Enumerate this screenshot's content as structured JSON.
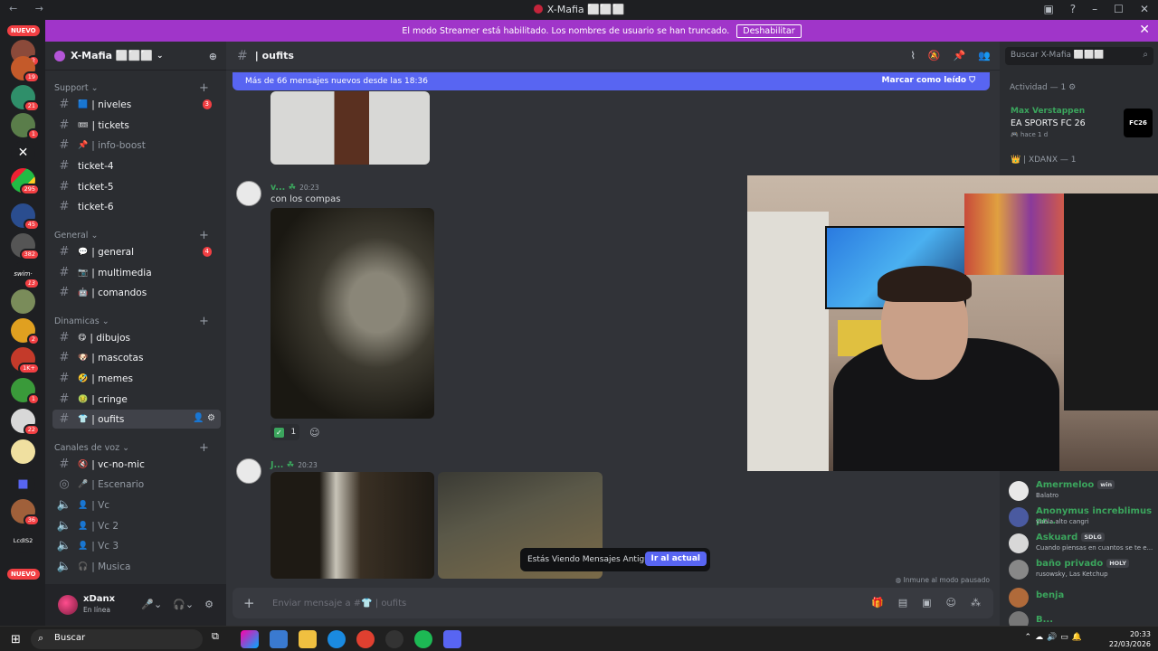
{
  "window": {
    "title": "X-Mafia ⬜⬜⬜",
    "nav": "← →"
  },
  "banner": {
    "text": "El modo Streamer está habilitado. Los nombres de usuario se han truncado.",
    "button": "Deshabilitar"
  },
  "rail": {
    "nuevo_top": "NUEVO",
    "nuevo_bottom": "NUEVO",
    "badges": [
      "2",
      "19",
      "21",
      "1",
      "295",
      "45",
      "382",
      "13",
      "2",
      "1K+",
      "1",
      "22",
      "36"
    ],
    "swimo_label": "swim·",
    "lcdis_label": "LcdIS2"
  },
  "server": {
    "name": "X-Mafia ⬜⬜⬜"
  },
  "sidebar": {
    "categories": {
      "support": "Support",
      "general": "General",
      "dinamicas": "Dinamicas",
      "voz": "Canales de voz"
    },
    "channels": [
      {
        "name": "| niveles",
        "emoji": "🟦",
        "badge": "3"
      },
      {
        "name": "| tickets",
        "emoji": "🎟"
      },
      {
        "name": "| info-boost",
        "emoji": "📌"
      },
      {
        "name": "ticket-4"
      },
      {
        "name": "ticket-5"
      },
      {
        "name": "ticket-6"
      },
      {
        "name": "| general",
        "emoji": "💬",
        "badge": "4"
      },
      {
        "name": "| multimedia",
        "emoji": "📷"
      },
      {
        "name": "| comandos",
        "emoji": "🤖"
      },
      {
        "name": "| dibujos",
        "emoji": "😋"
      },
      {
        "name": "| mascotas",
        "emoji": "🐶"
      },
      {
        "name": "| memes",
        "emoji": "🤣"
      },
      {
        "name": "| cringe",
        "emoji": "🤢"
      },
      {
        "name": "| oufits",
        "emoji": "👕"
      }
    ],
    "voice": [
      {
        "name": "| vc-no-mic",
        "emoji": "🔇"
      },
      {
        "name": "| Escenario",
        "emoji": "🎤"
      },
      {
        "name": "| Vc"
      },
      {
        "name": "| Vc 2"
      },
      {
        "name": "| Vc 3"
      },
      {
        "name": "| Musica"
      }
    ]
  },
  "user": {
    "name": "xDanx",
    "status": "En línea"
  },
  "channel": {
    "name": "| oufits"
  },
  "newbar": {
    "text": "Más de 66 mensajes nuevos desde las 18:36",
    "mark": "Marcar como leído"
  },
  "messages": [
    {
      "author": "v...",
      "time": "20:23",
      "text": "con los compas",
      "reaction_count": "1"
    },
    {
      "author": "J...",
      "time": "20:23"
    }
  ],
  "old_messages": {
    "text": "Estás Viendo Mensajes Antiguos",
    "button": "Ir al actual"
  },
  "immune": "Inmune al modo pausado",
  "input": {
    "placeholder": "Enviar mensaje a #👕 | oufits"
  },
  "search": {
    "placeholder": "Buscar X-Mafia ⬜⬜⬜"
  },
  "activity": {
    "header": "Actividad — 1",
    "user": "Max Verstappen",
    "game": "EA SPORTS FC 26",
    "time": "hace 1 d",
    "logo": "FC26"
  },
  "role": {
    "label": "| XDANX — 1"
  },
  "members": [
    {
      "name": "Amermeloo",
      "tag": "win",
      "status": "Balatro",
      "color": "#3ba55d"
    },
    {
      "name": "Anonymus increblimus pr...",
      "status": "vuela alto cangri",
      "color": "#3ba55d"
    },
    {
      "name": "Askuard",
      "tag": "SDLG",
      "status": "Cuando piensas en cuantos se te e...",
      "color": "#3ba55d"
    },
    {
      "name": "baño privado",
      "tag": "HOLY",
      "status": "rusowsky, Las Ketchup",
      "color": "#3ba55d"
    },
    {
      "name": "benja",
      "status": "",
      "color": "#3ba55d"
    },
    {
      "name": "B...",
      "status": "",
      "color": "#3ba55d"
    }
  ],
  "taskbar": {
    "search": "Buscar",
    "time": "20:33",
    "date": "22/03/2026"
  }
}
